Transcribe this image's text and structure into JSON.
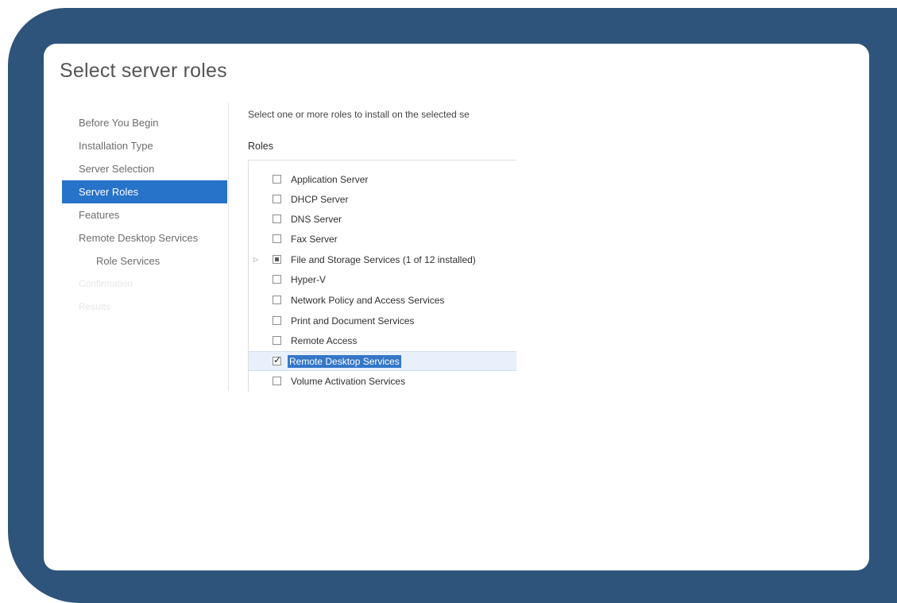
{
  "page": {
    "title": "Select server roles"
  },
  "nav": {
    "items": [
      {
        "label": "Before You Begin",
        "state": "normal"
      },
      {
        "label": "Installation Type",
        "state": "normal"
      },
      {
        "label": "Server Selection",
        "state": "normal"
      },
      {
        "label": "Server Roles",
        "state": "active"
      },
      {
        "label": "Features",
        "state": "normal"
      },
      {
        "label": "Remote Desktop Services",
        "state": "normal"
      },
      {
        "label": "Role Services",
        "state": "sub"
      },
      {
        "label": "Confirmation",
        "state": "disabled"
      },
      {
        "label": "Results",
        "state": "disabled"
      }
    ]
  },
  "main": {
    "instruction": "Select one or more roles to install on the selected se",
    "roles_label": "Roles",
    "roles": [
      {
        "label": "Application Server",
        "checked": "false",
        "expandable": "false"
      },
      {
        "label": "DHCP Server",
        "checked": "false",
        "expandable": "false"
      },
      {
        "label": "DNS Server",
        "checked": "false",
        "expandable": "false"
      },
      {
        "label": "Fax Server",
        "checked": "false",
        "expandable": "false"
      },
      {
        "label": "File and Storage Services (1 of 12 installed)",
        "checked": "partial",
        "expandable": "true"
      },
      {
        "label": "Hyper-V",
        "checked": "false",
        "expandable": "false"
      },
      {
        "label": "Network Policy and Access Services",
        "checked": "false",
        "expandable": "false"
      },
      {
        "label": "Print and Document Services",
        "checked": "false",
        "expandable": "false"
      },
      {
        "label": "Remote Access",
        "checked": "false",
        "expandable": "false"
      },
      {
        "label": "Remote Desktop Services",
        "checked": "true",
        "expandable": "false",
        "selected": "true"
      },
      {
        "label": "Volume Activation Services",
        "checked": "false",
        "expandable": "false"
      }
    ],
    "expander_glyph": "▷",
    "check_glyph": "✓"
  },
  "colors": {
    "frame": "#2e547b",
    "nav_active": "#2773c9",
    "selection_highlight": "#3477c8"
  }
}
